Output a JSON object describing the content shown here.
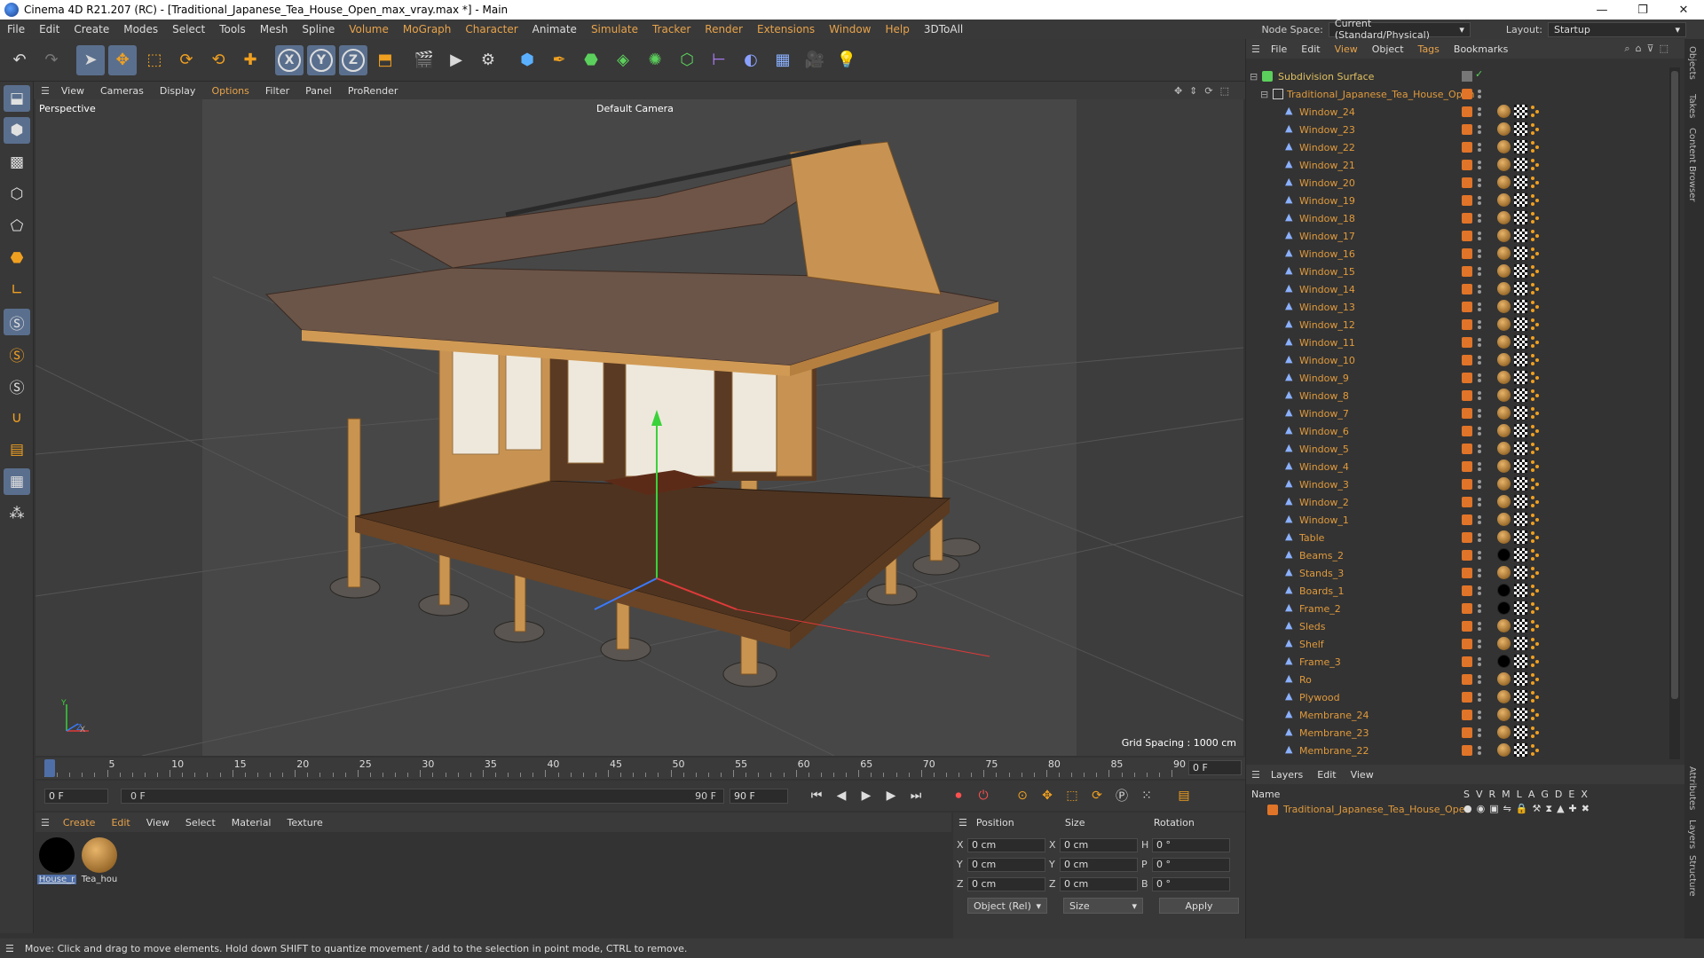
{
  "window": {
    "title": "Cinema 4D R21.207 (RC) - [Traditional_Japanese_Tea_House_Open_max_vray.max *] - Main",
    "minimize": "—",
    "restore": "❐",
    "close": "✕"
  },
  "menubar": {
    "items": [
      "File",
      "Edit",
      "Create",
      "Modes",
      "Select",
      "Tools",
      "Mesh",
      "Spline",
      "Volume",
      "MoGraph",
      "Character",
      "Animate",
      "Simulate",
      "Tracker",
      "Render",
      "Extensions",
      "Window",
      "Help",
      "3DToAll"
    ],
    "node_space_label": "Node Space:",
    "node_space_value": "Current (Standard/Physical)",
    "layout_label": "Layout:",
    "layout_value": "Startup"
  },
  "viewport_menu": [
    "View",
    "Cameras",
    "Display",
    "Options",
    "Filter",
    "Panel",
    "ProRender"
  ],
  "viewport": {
    "label": "Perspective",
    "camera": "Default Camera",
    "grid_spacing": "Grid Spacing : 1000 cm",
    "axis_y": "Y",
    "axis_x": "X",
    "axis_z": "Z"
  },
  "timeline": {
    "ticks": [
      "0",
      "5",
      "10",
      "15",
      "20",
      "25",
      "30",
      "35",
      "40",
      "45",
      "50",
      "55",
      "60",
      "65",
      "70",
      "75",
      "80",
      "85",
      "90"
    ],
    "current_frame": "0 F"
  },
  "playback": {
    "start_field": "0 F",
    "range_start": "0 F",
    "range_end": "90 F",
    "end_field": "90 F"
  },
  "material_menu": [
    "Create",
    "Edit",
    "View",
    "Select",
    "Material",
    "Texture"
  ],
  "materials": [
    {
      "name": "House_r",
      "color": "#000000"
    },
    {
      "name": "Tea_hou",
      "color": "#b0803a"
    }
  ],
  "coords": {
    "position_label": "Position",
    "size_label": "Size",
    "rotation_label": "Rotation",
    "rows": [
      {
        "axis": "X",
        "pos": "0 cm",
        "size_axis": "X",
        "size": "0 cm",
        "rot_axis": "H",
        "rot": "0 °"
      },
      {
        "axis": "Y",
        "pos": "0 cm",
        "size_axis": "Y",
        "size": "0 cm",
        "rot_axis": "P",
        "rot": "0 °"
      },
      {
        "axis": "Z",
        "pos": "0 cm",
        "size_axis": "Z",
        "size": "0 cm",
        "rot_axis": "B",
        "rot": "0 °"
      }
    ],
    "mode": "Object (Rel)",
    "size_mode": "Size",
    "apply": "Apply"
  },
  "object_manager": {
    "menu": [
      "File",
      "Edit",
      "View",
      "Object",
      "Tags",
      "Bookmarks"
    ],
    "root": "Subdivision Surface",
    "group": "Traditional_Japanese_Tea_House_Open",
    "children": [
      {
        "name": "Window_24",
        "mat": "wood"
      },
      {
        "name": "Window_23",
        "mat": "wood"
      },
      {
        "name": "Window_22",
        "mat": "wood"
      },
      {
        "name": "Window_21",
        "mat": "wood"
      },
      {
        "name": "Window_20",
        "mat": "wood"
      },
      {
        "name": "Window_19",
        "mat": "wood"
      },
      {
        "name": "Window_18",
        "mat": "wood"
      },
      {
        "name": "Window_17",
        "mat": "wood"
      },
      {
        "name": "Window_16",
        "mat": "wood"
      },
      {
        "name": "Window_15",
        "mat": "wood"
      },
      {
        "name": "Window_14",
        "mat": "wood"
      },
      {
        "name": "Window_13",
        "mat": "wood"
      },
      {
        "name": "Window_12",
        "mat": "wood"
      },
      {
        "name": "Window_11",
        "mat": "wood"
      },
      {
        "name": "Window_10",
        "mat": "wood"
      },
      {
        "name": "Window_9",
        "mat": "wood"
      },
      {
        "name": "Window_8",
        "mat": "wood"
      },
      {
        "name": "Window_7",
        "mat": "wood"
      },
      {
        "name": "Window_6",
        "mat": "wood"
      },
      {
        "name": "Window_5",
        "mat": "wood"
      },
      {
        "name": "Window_4",
        "mat": "wood"
      },
      {
        "name": "Window_3",
        "mat": "wood"
      },
      {
        "name": "Window_2",
        "mat": "wood"
      },
      {
        "name": "Window_1",
        "mat": "wood"
      },
      {
        "name": "Table",
        "mat": "wood"
      },
      {
        "name": "Beams_2",
        "mat": "black"
      },
      {
        "name": "Stands_3",
        "mat": "wood"
      },
      {
        "name": "Boards_1",
        "mat": "black"
      },
      {
        "name": "Frame_2",
        "mat": "black"
      },
      {
        "name": "Sleds",
        "mat": "wood"
      },
      {
        "name": "Shelf",
        "mat": "wood"
      },
      {
        "name": "Frame_3",
        "mat": "black"
      },
      {
        "name": "Ro",
        "mat": "wood"
      },
      {
        "name": "Plywood",
        "mat": "wood"
      },
      {
        "name": "Membrane_24",
        "mat": "wood"
      },
      {
        "name": "Membrane_23",
        "mat": "wood"
      },
      {
        "name": "Membrane_22",
        "mat": "wood"
      }
    ]
  },
  "layers": {
    "menu": [
      "Layers",
      "Edit",
      "View"
    ],
    "name_header": "Name",
    "flags": [
      "S",
      "V",
      "R",
      "M",
      "L",
      "A",
      "G",
      "D",
      "E",
      "X"
    ],
    "row": "Traditional_Japanese_Tea_House_Open"
  },
  "side_tabs": [
    "Objects",
    "Takes",
    "Content Browser",
    "Attributes",
    "Layers",
    "Structure"
  ],
  "status": "Move: Click and drag to move elements. Hold down SHIFT to quantize movement / add to the selection in point mode, CTRL to remove.",
  "colors": {
    "accent": "#e8a34a",
    "layer": "#e07428",
    "active_tool": "#5a6f8e"
  }
}
